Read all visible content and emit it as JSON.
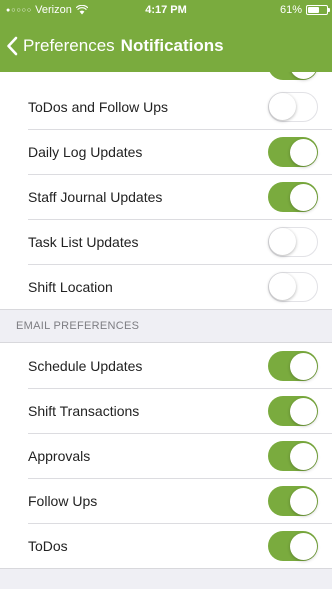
{
  "status_bar": {
    "signal_dots": "●○○○○",
    "carrier": "Verizon",
    "time": "4:17 PM",
    "battery_percent": "61%",
    "battery_level": 0.61
  },
  "nav": {
    "back_label": "Preferences",
    "title": "Notifications"
  },
  "colors": {
    "accent": "#7aab3e",
    "background": "#efeff4"
  },
  "top_partial_row": {
    "enabled": true
  },
  "sections": [
    {
      "header": "",
      "items": [
        {
          "label": "ToDos and Follow Ups",
          "enabled": false
        },
        {
          "label": "Daily Log Updates",
          "enabled": true
        },
        {
          "label": "Staff Journal Updates",
          "enabled": true
        },
        {
          "label": "Task List Updates",
          "enabled": false
        },
        {
          "label": "Shift Location",
          "enabled": false
        }
      ]
    },
    {
      "header": "EMAIL PREFERENCES",
      "items": [
        {
          "label": "Schedule Updates",
          "enabled": true
        },
        {
          "label": "Shift Transactions",
          "enabled": true
        },
        {
          "label": "Approvals",
          "enabled": true
        },
        {
          "label": "Follow Ups",
          "enabled": true
        },
        {
          "label": "ToDos",
          "enabled": true
        }
      ]
    }
  ]
}
